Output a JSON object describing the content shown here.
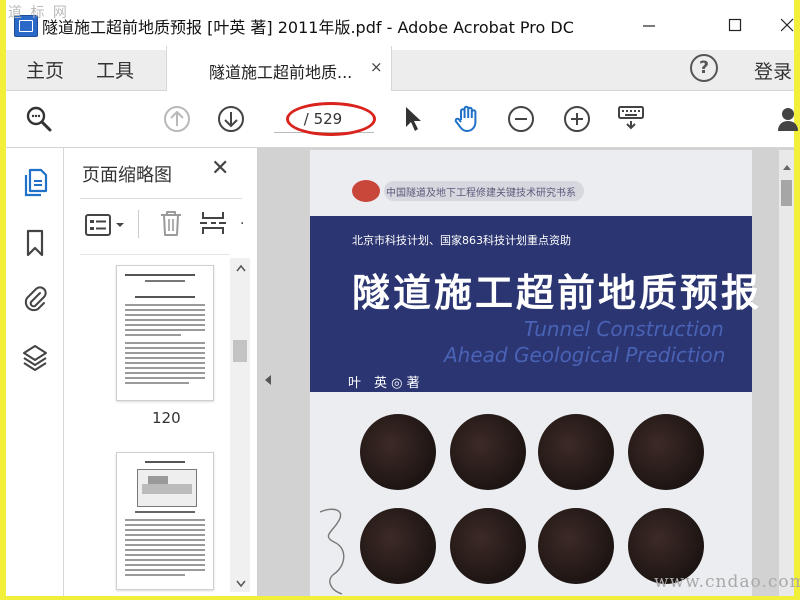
{
  "watermark_top": "道 标 网",
  "window": {
    "title": "隧道施工超前地质预报 [叶英 著] 2011年版.pdf - Adobe Acrobat Pro DC",
    "minimize": "—",
    "maximize": "☐",
    "close": "✕"
  },
  "menu": {
    "home": "主页",
    "tools": "工具",
    "doc_tab_label": "隧道施工超前地质...",
    "doc_tab_close": "×",
    "help": "?",
    "login": "登录"
  },
  "toolbar": {
    "page_count": "/ 529"
  },
  "thumbnail_panel": {
    "title": "页面缩略图",
    "close": "✕",
    "thumbs": [
      {
        "label": "120"
      }
    ]
  },
  "cover": {
    "series": "中国隧道及地下工程修建关键技术研究书系",
    "funding": "北京市科技计划、国家863科技计划重点资助",
    "title": "隧道施工超前地质预报",
    "english_line1": "Tunnel Construction",
    "english_line2": "Ahead Geological Prediction",
    "author": "叶　英 ◎ 著"
  },
  "watermark_bottom": "www.cndao.com",
  "colors": {
    "frame": "#f2ef3a",
    "cover_band": "#2b3571",
    "annotation_ellipse": "#d9231c",
    "acrobat_blue": "#2a69c8"
  }
}
